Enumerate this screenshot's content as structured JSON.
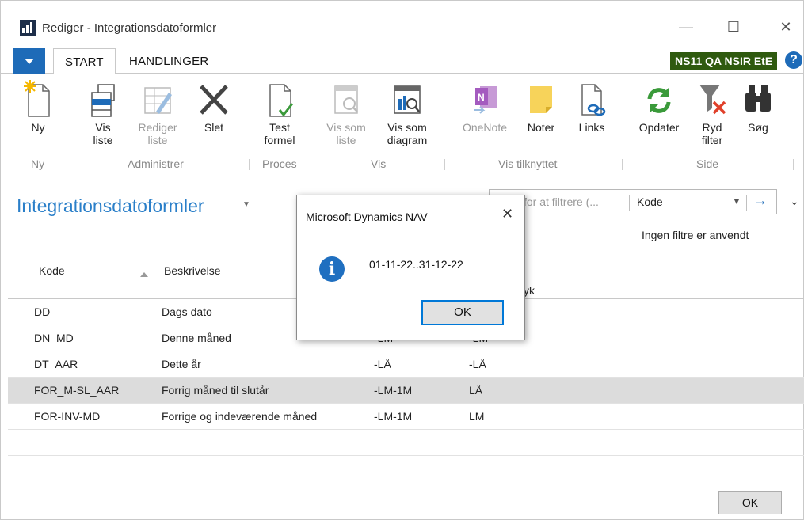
{
  "window": {
    "title": "Rediger - Integrationsdatoformler",
    "controls": [
      "minimize-icon",
      "maximize-icon",
      "close-icon"
    ]
  },
  "tabs": [
    {
      "label": "START",
      "active": true
    },
    {
      "label": "HANDLINGER",
      "active": false
    }
  ],
  "environment_badge": "NS11 QA NSIR EtE",
  "help": "?",
  "ribbon": {
    "buttons": {
      "ny": {
        "line1": "Ny",
        "line2": "",
        "icon": "new-document-icon"
      },
      "vis_liste": {
        "line1": "Vis",
        "line2": "liste",
        "icon": "view-list-icon"
      },
      "rediger_liste": {
        "line1": "Rediger",
        "line2": "liste",
        "icon": "edit-list-icon"
      },
      "slet": {
        "line1": "Slet",
        "line2": "",
        "icon": "delete-x-icon"
      },
      "test_formel": {
        "line1": "Test",
        "line2": "formel",
        "icon": "test-document-icon"
      },
      "vis_som_liste": {
        "line1": "Vis som",
        "line2": "liste",
        "icon": "show-as-list-icon"
      },
      "vis_som_diagram": {
        "line1": "Vis som",
        "line2": "diagram",
        "icon": "show-as-chart-icon"
      },
      "onenote": {
        "line1": "OneNote",
        "line2": "",
        "icon": "onenote-icon"
      },
      "noter": {
        "line1": "Noter",
        "line2": "",
        "icon": "note-icon"
      },
      "links": {
        "line1": "Links",
        "line2": "",
        "icon": "links-icon"
      },
      "opdater": {
        "line1": "Opdater",
        "line2": "",
        "icon": "refresh-icon"
      },
      "ryd_filter": {
        "line1": "Ryd",
        "line2": "filter",
        "icon": "clear-filter-icon"
      },
      "soeg": {
        "line1": "Søg",
        "line2": "",
        "icon": "binoculars-icon"
      }
    },
    "groups": {
      "ny": "Ny",
      "administrer": "Administrer",
      "proces": "Proces",
      "vis": "Vis",
      "vis_tilknyttet": "Vis tilknyttet",
      "side": "Side"
    }
  },
  "page": {
    "title": "Integrationsdatoformler",
    "filter_placeholder": "Skriv for at filtrere (...",
    "filter_field": "Kode",
    "no_filters": "Ingen filtre er anvendt"
  },
  "table": {
    "headers": {
      "kode": "Kode",
      "beskrivelse": "Beskrivelse",
      "udtryk": "yk"
    },
    "rows": [
      {
        "kode": "DD",
        "beskrivelse": "Dags dato",
        "f1": "",
        "f2": ""
      },
      {
        "kode": "DN_MD",
        "beskrivelse": "Denne måned",
        "f1": "-LM",
        "f2": "-LM"
      },
      {
        "kode": "DT_AAR",
        "beskrivelse": "Dette år",
        "f1": "-LÅ",
        "f2": "-LÅ"
      },
      {
        "kode": "FOR_M-SL_AAR",
        "beskrivelse": "Forrig måned til slutår",
        "f1": "-LM-1M",
        "f2": "LÅ"
      },
      {
        "kode": "FOR-INV-MD",
        "beskrivelse": "Forrige og indeværende måned",
        "f1": "-LM-1M",
        "f2": "LM"
      }
    ]
  },
  "ok_label": "OK",
  "dialog": {
    "title": "Microsoft Dynamics NAV",
    "message": "01-11-22..31-12-22",
    "ok_label": "OK",
    "icon": "info-icon"
  },
  "colors": {
    "accent": "#1e6bb8",
    "title_blue": "#2a7fc9",
    "badge_green": "#2f5a0f",
    "selected_row": "#dcdcdc"
  }
}
